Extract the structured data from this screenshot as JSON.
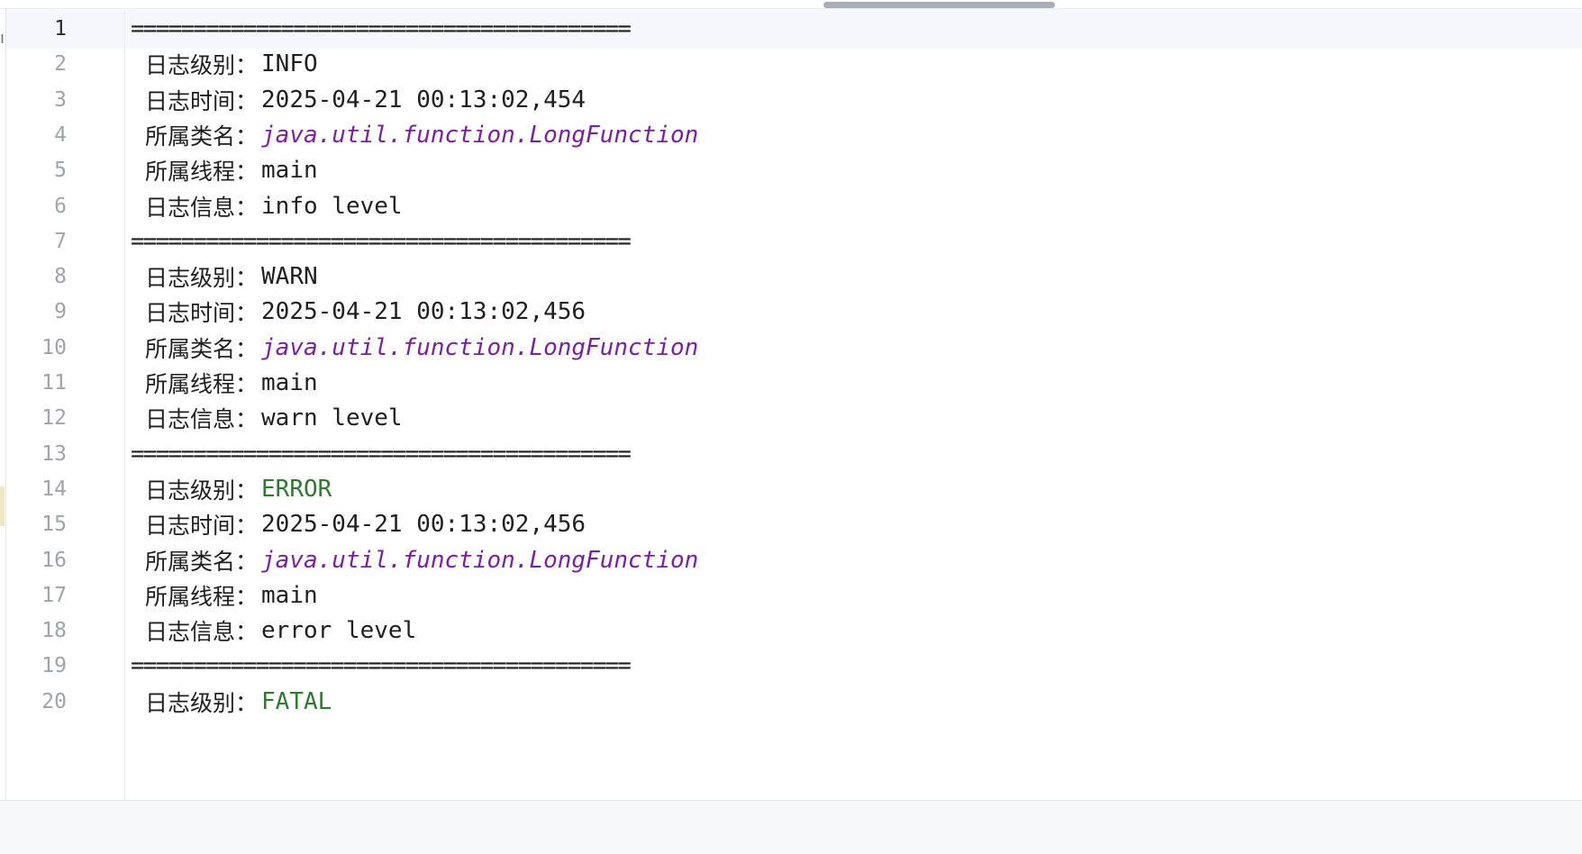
{
  "editor": {
    "separator": "========================================",
    "current_line": 1,
    "level_colors": {
      "INFO": "#1f1f1f",
      "WARN": "#1f1f1f",
      "ERROR": "#2e7a2e",
      "FATAL": "#2e7a2e"
    },
    "class_color": "#7b1fa2",
    "lines": [
      {
        "num": "1",
        "type": "separator"
      },
      {
        "num": "2",
        "type": "field",
        "label": "日志级别",
        "colon": "：",
        "value": "INFO",
        "kind": "level-info"
      },
      {
        "num": "3",
        "type": "field",
        "label": "日志时间",
        "colon": "：",
        "value": "2025-04-21 00:13:02,454",
        "kind": "plain"
      },
      {
        "num": "4",
        "type": "field",
        "label": "所属类名",
        "colon": "：",
        "value": "java.util.function.LongFunction",
        "kind": "class"
      },
      {
        "num": "5",
        "type": "field",
        "label": "所属线程",
        "colon": "：",
        "value": "main",
        "kind": "plain"
      },
      {
        "num": "6",
        "type": "field",
        "label": "日志信息",
        "colon": "：",
        "value": "info level",
        "kind": "plain"
      },
      {
        "num": "7",
        "type": "separator"
      },
      {
        "num": "8",
        "type": "field",
        "label": "日志级别",
        "colon": "：",
        "value": "WARN",
        "kind": "level-warn"
      },
      {
        "num": "9",
        "type": "field",
        "label": "日志时间",
        "colon": "：",
        "value": "2025-04-21 00:13:02,456",
        "kind": "plain"
      },
      {
        "num": "10",
        "type": "field",
        "label": "所属类名",
        "colon": "：",
        "value": "java.util.function.LongFunction",
        "kind": "class"
      },
      {
        "num": "11",
        "type": "field",
        "label": "所属线程",
        "colon": "：",
        "value": "main",
        "kind": "plain"
      },
      {
        "num": "12",
        "type": "field",
        "label": "日志信息",
        "colon": "：",
        "value": "warn level",
        "kind": "plain"
      },
      {
        "num": "13",
        "type": "separator"
      },
      {
        "num": "14",
        "type": "field",
        "label": "日志级别",
        "colon": "：",
        "value": "ERROR",
        "kind": "level-error"
      },
      {
        "num": "15",
        "type": "field",
        "label": "日志时间",
        "colon": "：",
        "value": "2025-04-21 00:13:02,456",
        "kind": "plain"
      },
      {
        "num": "16",
        "type": "field",
        "label": "所属类名",
        "colon": "：",
        "value": "java.util.function.LongFunction",
        "kind": "class"
      },
      {
        "num": "17",
        "type": "field",
        "label": "所属线程",
        "colon": "：",
        "value": "main",
        "kind": "plain"
      },
      {
        "num": "18",
        "type": "field",
        "label": "日志信息",
        "colon": "：",
        "value": "error level",
        "kind": "plain"
      },
      {
        "num": "19",
        "type": "separator"
      },
      {
        "num": "20",
        "type": "field",
        "label": "日志级别",
        "colon": "：",
        "value": "FATAL",
        "kind": "level-fatal"
      }
    ]
  }
}
